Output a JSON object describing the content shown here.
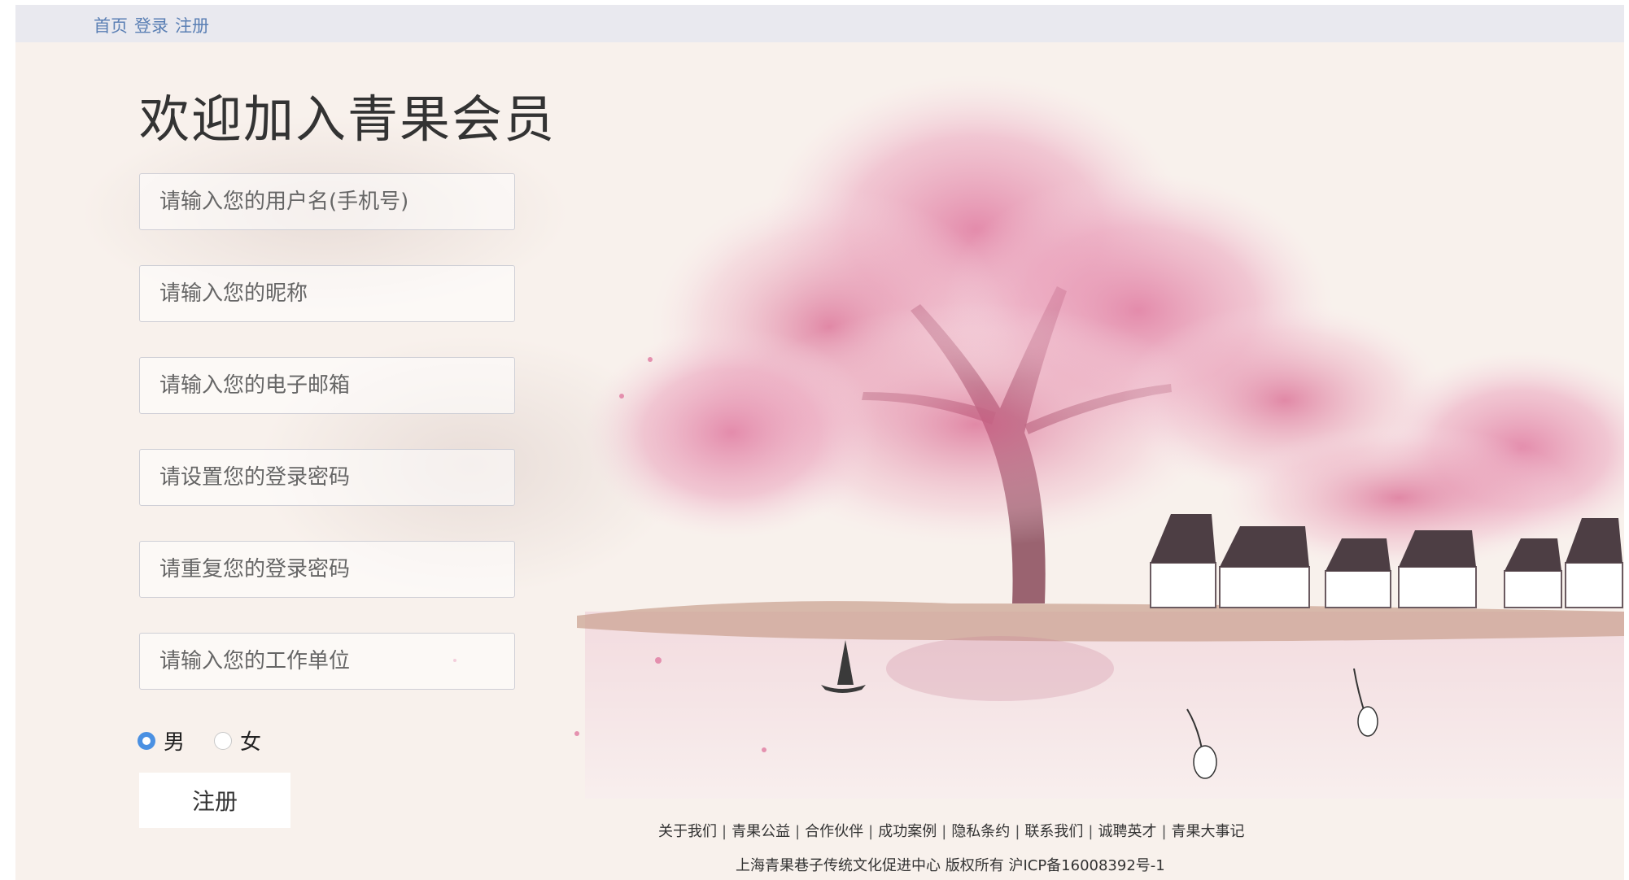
{
  "nav": {
    "home": "首页",
    "login": "登录",
    "register": "注册"
  },
  "heading": "欢迎加入青果会员",
  "form": {
    "username_placeholder": "请输入您的用户名(手机号)",
    "nickname_placeholder": "请输入您的昵称",
    "email_placeholder": "请输入您的电子邮箱",
    "password_placeholder": "请设置您的登录密码",
    "password_confirm_placeholder": "请重复您的登录密码",
    "workplace_placeholder": "请输入您的工作单位",
    "gender_male": "男",
    "gender_female": "女",
    "gender_selected": "男",
    "submit_label": "注册"
  },
  "footer": {
    "links": [
      "关于我们",
      "青果公益",
      "合作伙伴",
      "成功案例",
      "隐私条约",
      "联系我们",
      "诚聘英才",
      "青果大事记"
    ],
    "copyright": "上海青果巷子传统文化促进中心 版权所有 沪ICP备16008392号-1"
  },
  "colors": {
    "nav_link": "#5a7fb4",
    "radio_checked": "#4a90e2",
    "blossom": "#e59ab4"
  }
}
